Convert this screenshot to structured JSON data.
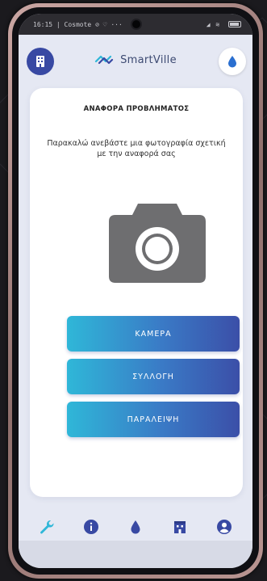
{
  "status_bar": {
    "time_carrier": "16:15 | Cosmote ⊘ ♡ ···",
    "right_icons": "◢ ≋"
  },
  "app_bar": {
    "brand_name": "SmartVille",
    "left_button_icon": "building-icon",
    "right_button_icon": "water-drop-icon"
  },
  "report": {
    "title": "ΑΝΑΦΟΡΑ ΠΡΟΒΛΗΜΑΤΟΣ",
    "message": "Παρακαλώ ανεβάστε μια φωτογραφία σχετική με την αναφορά σας",
    "image_icon": "camera-icon",
    "buttons": {
      "camera": "ΚΑΜΕΡΑ",
      "gallery": "ΣΥΛΛΟΓΗ",
      "skip": "ΠΑΡΑΛΕΙΨΗ"
    }
  },
  "bottom_nav": [
    {
      "icon": "wrench-icon",
      "active": true
    },
    {
      "icon": "info-icon",
      "active": false
    },
    {
      "icon": "water-drop-icon",
      "active": false
    },
    {
      "icon": "building-icon",
      "active": false
    },
    {
      "icon": "user-icon",
      "active": false
    }
  ],
  "colors": {
    "primary": "#3849a3",
    "accent_cyan": "#2fb7d8",
    "background": "#e5e8f3"
  }
}
